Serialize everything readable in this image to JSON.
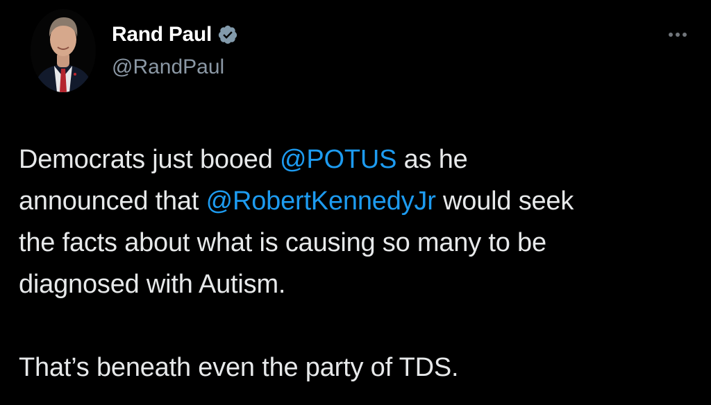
{
  "author": {
    "name": "Rand Paul",
    "handle": "@RandPaul",
    "verified": true,
    "avatar_icon": "profile-photo"
  },
  "menu": {
    "more_icon": "ellipsis-icon"
  },
  "tweet": {
    "paragraph1": {
      "line1": {
        "before": "Democrats just booed ",
        "mention": "@POTUS",
        "after": " as he"
      },
      "line2": {
        "before": "announced that ",
        "mention": "@RobertKennedyJr",
        "after": " would seek"
      },
      "line3": "the facts about what is causing so many to be",
      "line4": "diagnosed with Autism."
    },
    "paragraph2": "That’s beneath even the party of TDS."
  },
  "colors": {
    "background": "#000000",
    "text": "#e7e9ea",
    "mention": "#1d9bf0",
    "secondary": "#8b98a5",
    "verified_badge": "#829aab"
  }
}
